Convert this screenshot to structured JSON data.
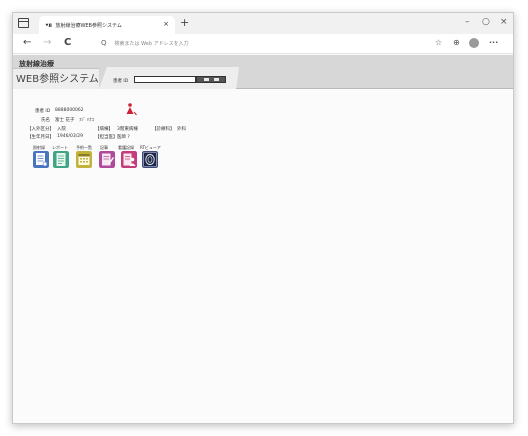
{
  "browser": {
    "tab_title": "放射線治療WEB参照システム",
    "address_placeholder": "検索または Web アドレスを入力",
    "new_tab_glyph": "+",
    "tab_close_glyph": "×",
    "minimize_glyph": "–",
    "maximize_glyph": "○",
    "close_glyph": "×",
    "back_glyph": "←",
    "forward_glyph": "→",
    "reload_glyph": "C",
    "search_glyph": "Q",
    "favorite_glyph": "☆",
    "collections_glyph": "⊕",
    "more_glyph": "···"
  },
  "app": {
    "hospital_name": "放射線治療",
    "system_title": "WEB参照システム",
    "patient_id_label": "患者 ID"
  },
  "patient": {
    "id_label": "患者 ID",
    "id_value": "8888000062",
    "name_label": "氏名",
    "name_value": "富士 花子",
    "name_kana": "ﾌｼﾞ ﾊﾅｺ",
    "admission_label": "【入外区分】",
    "admission_value": "入院",
    "ward_label": "【病棟】",
    "ward_value": "3階東病棟",
    "department_label": "【診療科】",
    "department_value": "外科",
    "birth_label": "【生年月日】",
    "birth_value": "1946/03/29",
    "physician_label": "【担当医】",
    "physician_value": "医師 ?"
  },
  "menu": {
    "items": [
      {
        "label": "照射録",
        "icon": "treatment-record-icon",
        "color": "#4a73c0"
      },
      {
        "label": "レポート",
        "icon": "report-icon",
        "color": "#3ea685"
      },
      {
        "label": "予約一覧",
        "icon": "reservation-list-icon",
        "color": "#c0b23a"
      },
      {
        "label": "記事",
        "icon": "notes-icon",
        "color": "#b04a9a"
      },
      {
        "label": "看護記録",
        "icon": "nursing-record-icon",
        "color": "#c23d7a"
      },
      {
        "label": "RTビューア",
        "icon": "rt-viewer-icon",
        "color": "#3d4a7a"
      }
    ]
  }
}
